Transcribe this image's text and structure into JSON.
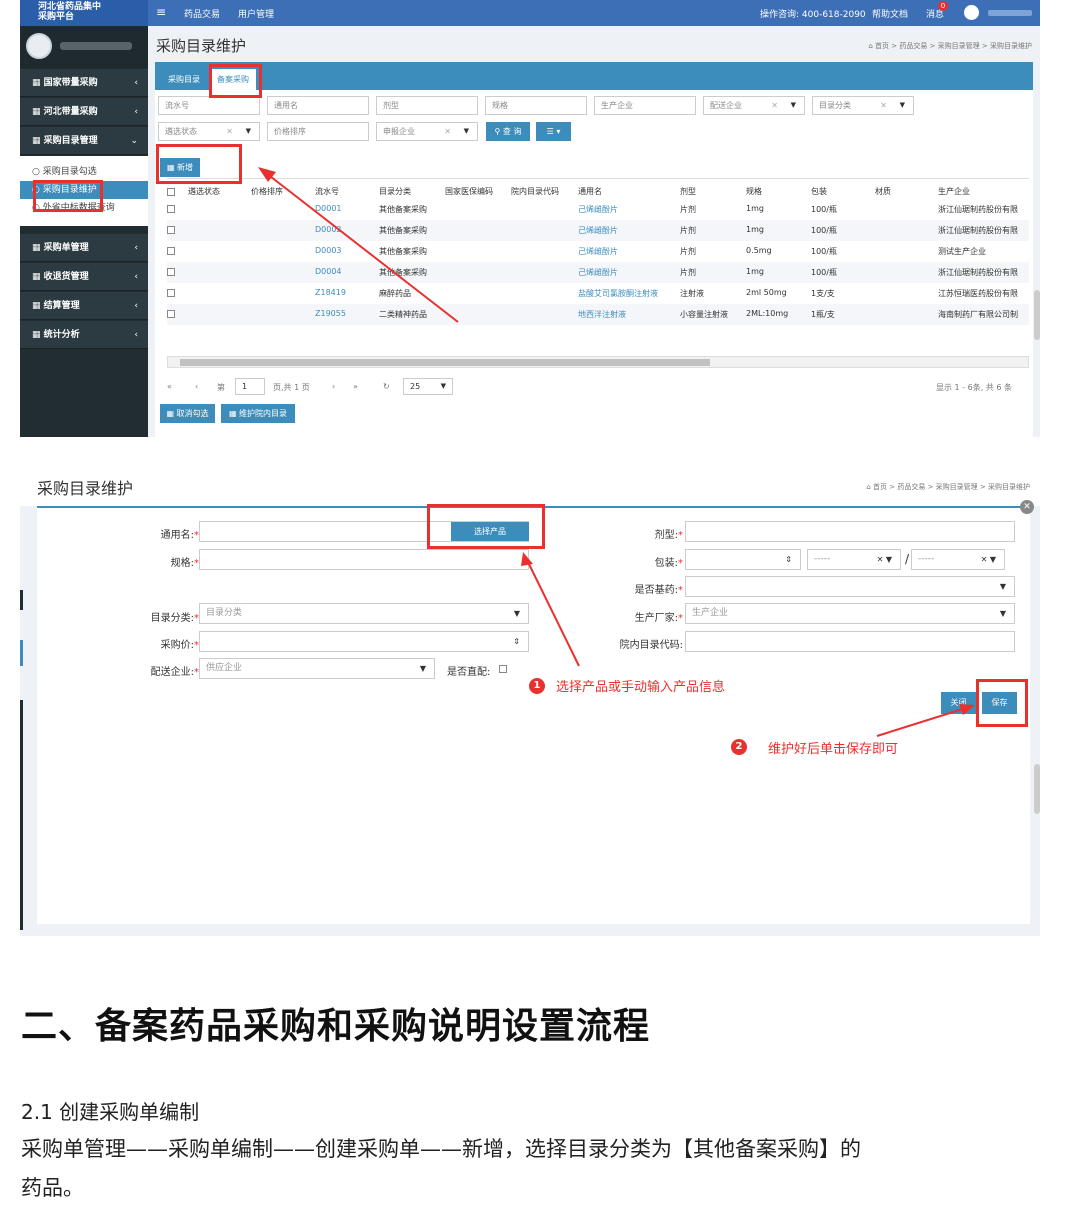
{
  "shot1": {
    "app_title_line1": "河北省药品集中",
    "app_title_line2": "采购平台",
    "nav": [
      "药品交易",
      "用户管理"
    ],
    "consult": "操作咨询: 400-618-2090",
    "help": "帮助文档",
    "messages": "消息",
    "msg_badge": "0",
    "sidebar": {
      "groups": [
        "国家带量采购",
        "河北带量采购",
        "采购目录管理",
        "采购单管理",
        "收退货管理",
        "结算管理",
        "统计分析"
      ],
      "subitems": [
        "采购目录勾选",
        "采购目录维护",
        "外省中标数据查询"
      ]
    },
    "page_title": "采购目录维护",
    "breadcrumb": "首页 > 药品交易 > 采购目录管理 > 采购目录维护",
    "tabs": [
      "采购目录",
      "备案采购"
    ],
    "filters_row1": [
      "流水号",
      "通用名",
      "剂型",
      "规格",
      "生产企业",
      "配送企业",
      "目录分类"
    ],
    "filters_row2": [
      "遴选状态",
      "价格排序",
      "申报企业"
    ],
    "query_btn": "查 询",
    "add_btn": "新增",
    "columns": [
      "遴选状态",
      "价格排序",
      "流水号",
      "目录分类",
      "国家医保编码",
      "院内目录代码",
      "通用名",
      "剂型",
      "规格",
      "包装",
      "材质",
      "生产企业"
    ],
    "rows": [
      {
        "serial": "D0001",
        "category": "其他备案采购",
        "name": "己烯雌酚片",
        "form": "片剂",
        "spec": "1mg",
        "pack": "100/瓶",
        "maker": "浙江仙琚制药股份有限"
      },
      {
        "serial": "D0002",
        "category": "其他备案采购",
        "name": "己烯雌酚片",
        "form": "片剂",
        "spec": "1mg",
        "pack": "100/瓶",
        "maker": "浙江仙琚制药股份有限"
      },
      {
        "serial": "D0003",
        "category": "其他备案采购",
        "name": "己烯雌酚片",
        "form": "片剂",
        "spec": "0.5mg",
        "pack": "100/瓶",
        "maker": "测试生产企业"
      },
      {
        "serial": "D0004",
        "category": "其他备案采购",
        "name": "己烯雌酚片",
        "form": "片剂",
        "spec": "1mg",
        "pack": "100/瓶",
        "maker": "浙江仙琚制药股份有限"
      },
      {
        "serial": "Z18419",
        "category": "麻醉药品",
        "name": "盐酸艾司氯胺酮注射液",
        "form": "注射液",
        "spec": "2ml 50mg",
        "pack": "1支/支",
        "maker": "江苏恒瑞医药股份有限"
      },
      {
        "serial": "Z19055",
        "category": "二类精神药品",
        "name": "地西泮注射液",
        "form": "小容量注射液",
        "spec": "2ML:10mg",
        "pack": "1瓶/支",
        "maker": "海南制药厂有限公司制"
      }
    ],
    "pager": {
      "prefix": "第",
      "page": "1",
      "suffix": "页,共 1 页",
      "size": "25",
      "summary": "显示 1 - 6条, 共 6 条"
    },
    "bottom_btns": [
      "取消勾选",
      "维护院内目录"
    ]
  },
  "shot2": {
    "page_title": "采购目录维护",
    "breadcrumb": "首页 > 药品交易 > 采购目录管理 > 采购目录维护",
    "labels": {
      "name": "通用名:",
      "form": "剂型:",
      "spec": "规格:",
      "pack": "包装:",
      "essential": "是否基药:",
      "category": "目录分类:",
      "maker": "生产厂家:",
      "price": "采购价:",
      "hospital_code": "院内目录代码:",
      "distributor": "配送企业:",
      "direct": "是否直配:"
    },
    "select_product_btn": "选择产品",
    "category_placeholder": "目录分类",
    "maker_placeholder": "生产企业",
    "distributor_placeholder": "供应企业",
    "pack_placeholder": "-----",
    "close_btn": "关闭",
    "save_btn": "保存",
    "note1_num": "1",
    "note1": "选择产品或手动输入产品信息",
    "note2_num": "2",
    "note2": "维护好后单击保存即可"
  },
  "doc": {
    "heading": "二、备案药品采购和采购说明设置流程",
    "sub": "2.1 创建采购单编制",
    "line1": "采购单管理——采购单编制——创建采购单——新增，选择目录分类为【其他备案采购】的",
    "line2": "药品。"
  }
}
